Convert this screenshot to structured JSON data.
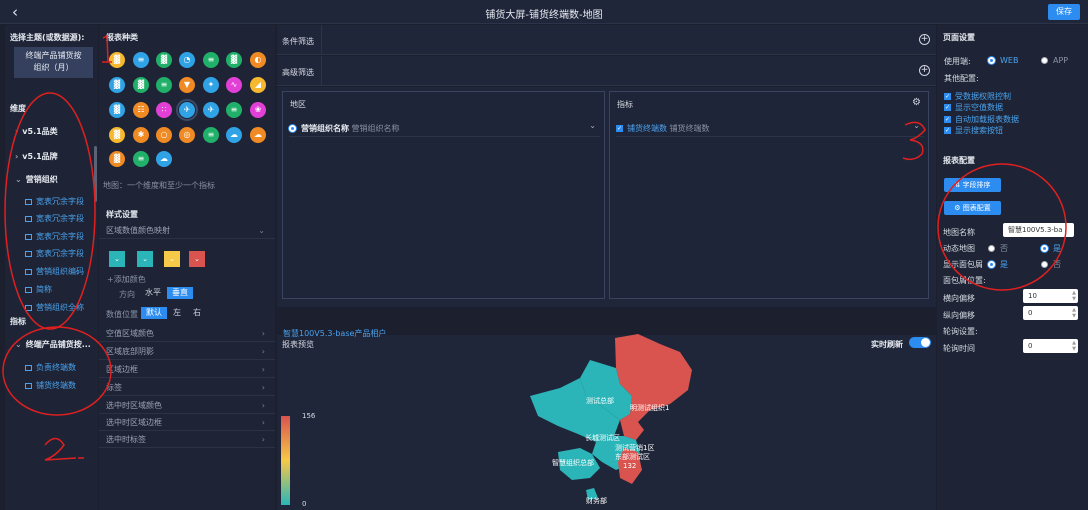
{
  "header": {
    "title": "铺货大屏-铺货终端数-地图",
    "save_label": "保存",
    "back_icon": "chevron-left-icon"
  },
  "left": {
    "theme_label": "选择主题(或数据源):",
    "theme_value_line1": "终端产品铺货按",
    "theme_value_line2": "组织（月）",
    "dimension_label": "维度",
    "groups": [
      {
        "label": "v5.1品类",
        "expanded": false
      },
      {
        "label": "v5.1品牌",
        "expanded": false
      },
      {
        "label": "营销组织",
        "expanded": true
      }
    ],
    "fields": [
      "宽表冗余字段",
      "宽表冗余字段",
      "宽表冗余字段",
      "宽表冗余字段",
      "营销组织编码",
      "简称",
      "营销组织全称"
    ],
    "metric_label": "指标",
    "metric_group": "终端产品铺货按...",
    "metric_fields": [
      "负责终端数",
      "铺货终端数"
    ]
  },
  "charts": {
    "label": "报表种类",
    "hint": "地图：一个维度和至少一个指标",
    "style_label": "样式设置",
    "color_map_label": "区域数值颜色映射",
    "add_color": "+添加颜色",
    "direction_label": "方向",
    "dir_h": "水平",
    "dir_v": "垂直",
    "value_pos_label": "数值位置",
    "pos_default": "默认",
    "pos_left": "左",
    "pos_right": "右",
    "sections": [
      "空值区域颜色",
      "区域底部阴影",
      "区域边框",
      "标签",
      "选中时区域颜色",
      "选中时区域边框",
      "选中时标签"
    ],
    "colors": {
      "teal": "#2bb5b8",
      "yellow": "#f7c948",
      "red": "#d9534f"
    }
  },
  "filters": {
    "cond": "条件筛选",
    "advanced": "高级筛选"
  },
  "region": {
    "label": "地区",
    "item_bold": "营销组织名称",
    "item_sub": "营销组织名称"
  },
  "metric": {
    "label": "指标",
    "item_bold": "铺货终端数",
    "item_sub": "铺货终端数"
  },
  "preview": {
    "label": "报表预览",
    "realtime_label": "实时刷新",
    "subtitle": "智慧100V5.3-base产品相户",
    "legend_max": "156",
    "legend_min": "0",
    "map_labels": [
      "测试总部",
      "明测试组织1",
      "长城测试区",
      "测试营销1区",
      "东部测试区",
      "132",
      "智慧组织总部",
      "财务部"
    ],
    "map_colors": {
      "low": "#2bb5b8",
      "high": "#d9534f"
    }
  },
  "right": {
    "page_settings": "页面设置",
    "use_end_label": "使用端:",
    "web": "WEB",
    "app": "APP",
    "other_label": "其他配置:",
    "options": [
      "受数据权限控制",
      "显示空值数据",
      "自动加载报表数据",
      "显示搜索按钮"
    ],
    "report_config": "报表配置",
    "sort_btn": "字段排序",
    "chart_cfg_btn": "图表配置",
    "map_name_label": "地图名称",
    "map_name_value": "智慧100V5.3-ba",
    "dyn_map_label": "动态地图",
    "no": "否",
    "yes": "是",
    "breadcrumb_label": "显示面包屑",
    "breadcrumb_pos_label": "面包屑位置:",
    "h_offset_label": "横向偏移",
    "h_offset_value": "10",
    "v_offset_label": "纵向偏移",
    "v_offset_value": "0",
    "carousel_label": "轮询设置:",
    "carousel_time_label": "轮询时间",
    "carousel_time_value": "0"
  }
}
